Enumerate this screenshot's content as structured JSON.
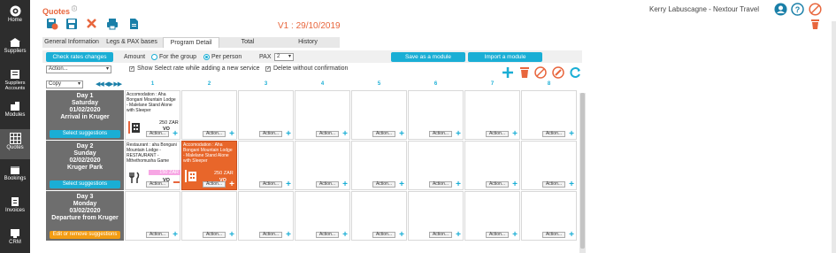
{
  "sidebar": {
    "items": [
      {
        "label": "Home",
        "icon": "home-icon"
      },
      {
        "label": "Suppliers",
        "icon": "suppliers-icon"
      },
      {
        "label": "Suppliers Accounts",
        "icon": "suppliers-accounts-icon"
      },
      {
        "label": "Modules",
        "icon": "modules-icon"
      },
      {
        "label": "Quotes",
        "icon": "quotes-icon",
        "active": true
      },
      {
        "label": "Bookings",
        "icon": "bookings-icon"
      },
      {
        "label": "Invoices",
        "icon": "invoices-icon"
      },
      {
        "label": "CRM",
        "icon": "crm-icon"
      }
    ]
  },
  "header": {
    "title": "Quotes",
    "help": "ⓘ",
    "user": "Kerry Labuscagne - Nextour Travel",
    "version": "V1 : 29/10/2019"
  },
  "tabs": [
    {
      "label": "General Information"
    },
    {
      "label": "Legs & PAX bases"
    },
    {
      "label": "Program Detail",
      "active": true
    },
    {
      "label": "Total"
    },
    {
      "label": "History"
    }
  ],
  "options": {
    "check_rates": "Check rates changes",
    "amount": "Amount",
    "for_group": "For the group",
    "per_person": "Per person",
    "pax_label": "PAX",
    "pax_value": "2",
    "save_module": "Save as a module",
    "import_module": "Import a module",
    "action_select": "Action...",
    "show_select_rate": "Show Select rate while adding a new service",
    "delete_without_confirm": "Delete without confirmation",
    "copy_select": "Copy"
  },
  "columns": [
    "1",
    "2",
    "3",
    "4",
    "5",
    "6",
    "7",
    "8"
  ],
  "days": [
    {
      "line1": "Day 1",
      "line2": "Saturday",
      "line3": "01/02/2020",
      "line4": "Arrival in Kruger",
      "button": "Select suggestions",
      "button_color": "#1aaed5"
    },
    {
      "line1": "Day 2",
      "line2": "Sunday",
      "line3": "02/02/2020",
      "line4": "Kruger Park",
      "button": "Select suggestions",
      "button_color": "#1aaed5"
    },
    {
      "line1": "Day 3",
      "line2": "Monday",
      "line3": "03/02/2020",
      "line4": "Departure from Kruger",
      "button": "Edit or remove suggestions",
      "button_color": "#f39c12"
    }
  ],
  "services": {
    "d1c1": {
      "text": "Accomodation : Aha Bongani Mountain Lodge - Malelane Stand Alone with Sleeper",
      "price": "250 ZAR",
      "vo": "VO"
    },
    "d2c1": {
      "text": "Restaurant : aha Bongani Mountain Lodge - RESTAURANT - Mthethomusha Game",
      "price": "150 ZAR",
      "vo": "VO"
    },
    "d2c2": {
      "text": "Accomodation : Aha Bongani Mountain Lodge - Malelane Stand Alone with Sleeper",
      "price": "250 ZAR",
      "vo": "VO"
    }
  },
  "action_label": "Action...",
  "colors": {
    "accent": "#1aaed5",
    "orange": "#e8663d",
    "selected_cell": "#e8662a",
    "sidebar": "#2d2d2d"
  }
}
